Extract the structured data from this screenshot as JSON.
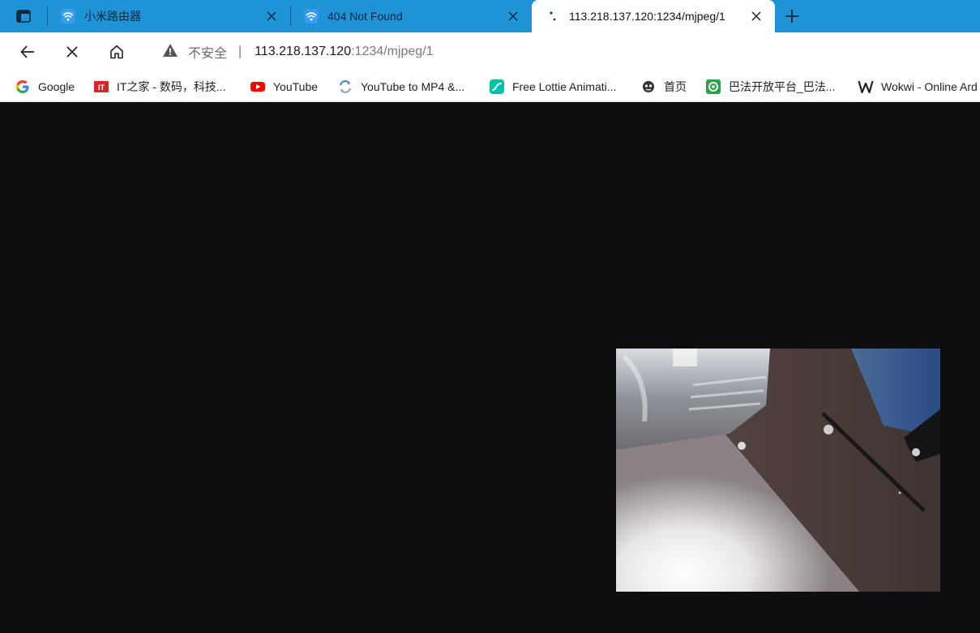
{
  "browser": {
    "tabs": [
      {
        "title": "小米路由器",
        "favicon": "wifi-icon"
      },
      {
        "title": "404 Not Found",
        "favicon": "wifi-icon"
      },
      {
        "title": "113.218.137.120:1234/mjpeg/1",
        "favicon": "loading-spinner-icon",
        "active": true
      }
    ],
    "address": {
      "security_label": "不安全",
      "divider": "|",
      "host": "113.218.137.120",
      "path": ":1234/mjpeg/1"
    },
    "loading": true,
    "bookmarks": [
      {
        "label": "Google",
        "icon": "google-icon"
      },
      {
        "label": "IT之家 - 数码，科技...",
        "icon": "ithome-icon"
      },
      {
        "label": "YouTube",
        "icon": "youtube-icon"
      },
      {
        "label": "YouTube to MP4 &...",
        "icon": "converter-icon"
      },
      {
        "label": "Free Lottie Animati...",
        "icon": "lottie-icon"
      },
      {
        "label": "首页",
        "icon": "home-page-icon"
      },
      {
        "label": "巴法开放平台_巴法...",
        "icon": "bemfa-icon"
      },
      {
        "label": "Wokwi - Online Ard",
        "icon": "wokwi-icon"
      }
    ]
  },
  "page": {
    "background": "#0e0e10",
    "content": "mjpeg-camera-stream"
  },
  "colors": {
    "tabstrip": "#1e94d6",
    "youtube_red": "#ff0000",
    "lottie_teal": "#00c1a8",
    "bemfa_green": "#2aa34a"
  }
}
